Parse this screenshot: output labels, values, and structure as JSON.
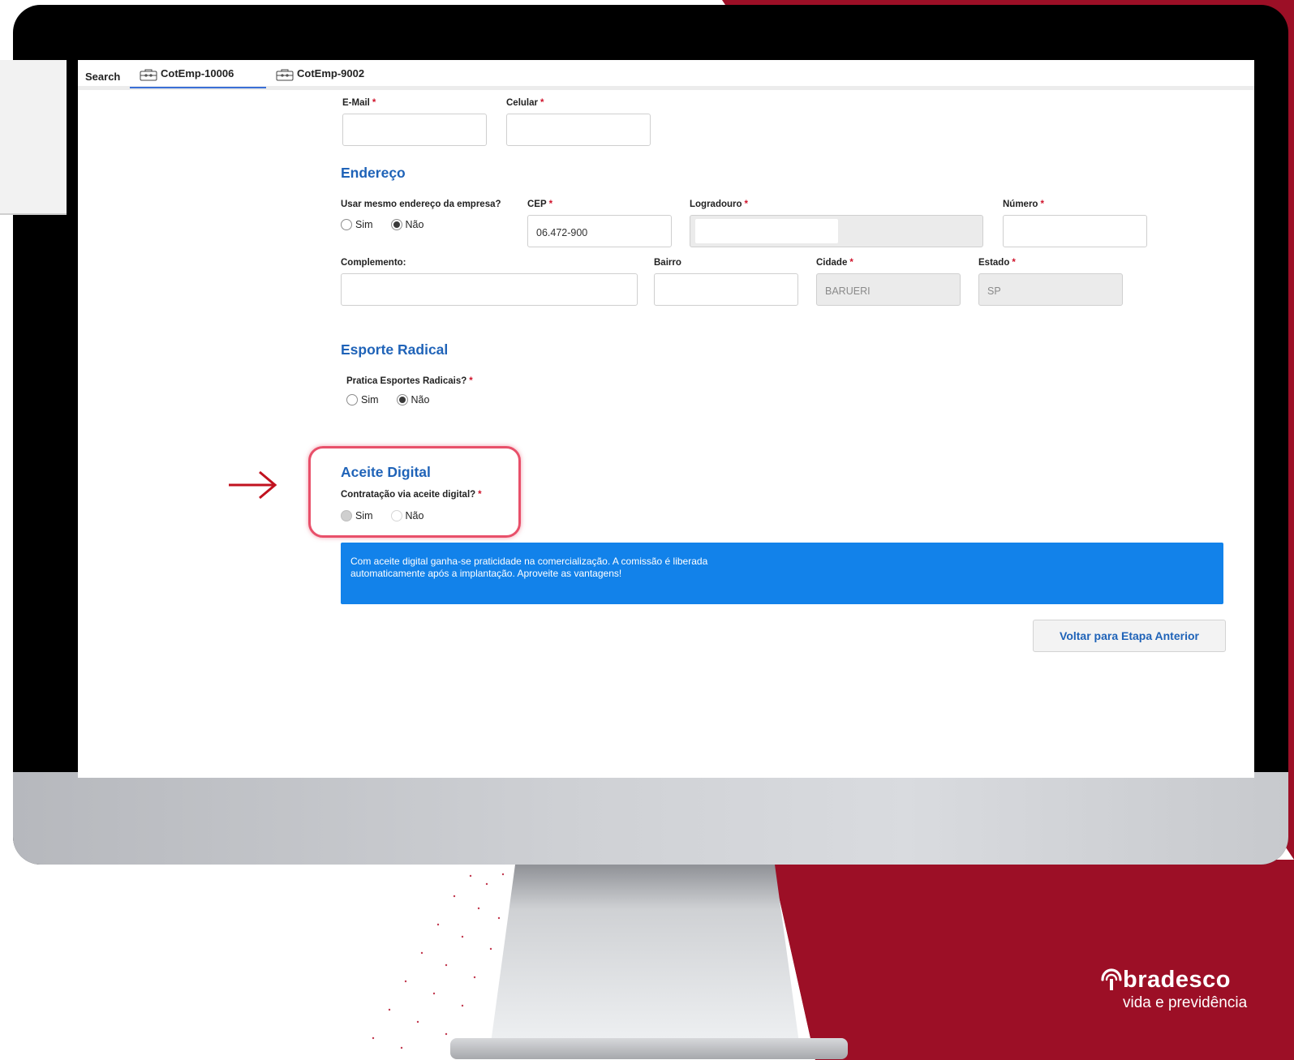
{
  "tabs": {
    "search_label": "Search",
    "items": [
      {
        "label": "CotEmp-10006",
        "active": true
      },
      {
        "label": "CotEmp-9002",
        "active": false
      }
    ]
  },
  "contact": {
    "email_label": "E-Mail",
    "email_value": "",
    "celular_label": "Celular",
    "celular_value": ""
  },
  "endereco": {
    "title": "Endereço",
    "same_address_label": "Usar mesmo endereço da empresa?",
    "options": [
      "Sim",
      "Não"
    ],
    "selected": "Não",
    "cep_label": "CEP",
    "cep_value": "06.472-900",
    "logradouro_label": "Logradouro",
    "logradouro_value": "",
    "numero_label": "Número",
    "numero_value": "",
    "complemento_label": "Complemento:",
    "complemento_value": "",
    "bairro_label": "Bairro",
    "bairro_value": "",
    "cidade_label": "Cidade",
    "cidade_value": "BARUERI",
    "estado_label": "Estado",
    "estado_value": "SP"
  },
  "esporte": {
    "title": "Esporte Radical",
    "question": "Pratica Esportes Radicais?",
    "options": [
      "Sim",
      "Não"
    ],
    "selected": "Não"
  },
  "aceite": {
    "title": "Aceite Digital",
    "question": "Contratação via aceite digital?",
    "options": [
      "Sim",
      "Não"
    ],
    "selected": "Sim",
    "info_line1": "Com aceite digital ganha-se praticidade na comercialização. A comissão é liberada",
    "info_line2": "automaticamente após a implantação. Aproveite as vantagens!"
  },
  "actions": {
    "back_label": "Voltar para Etapa Anterior"
  },
  "brand": {
    "name": "bradesco",
    "subtitle": "vida e previdência",
    "accent_red": "#9c0f26",
    "info_blue": "#1282ea",
    "title_blue": "#1f63b8"
  },
  "required_mark": "*"
}
